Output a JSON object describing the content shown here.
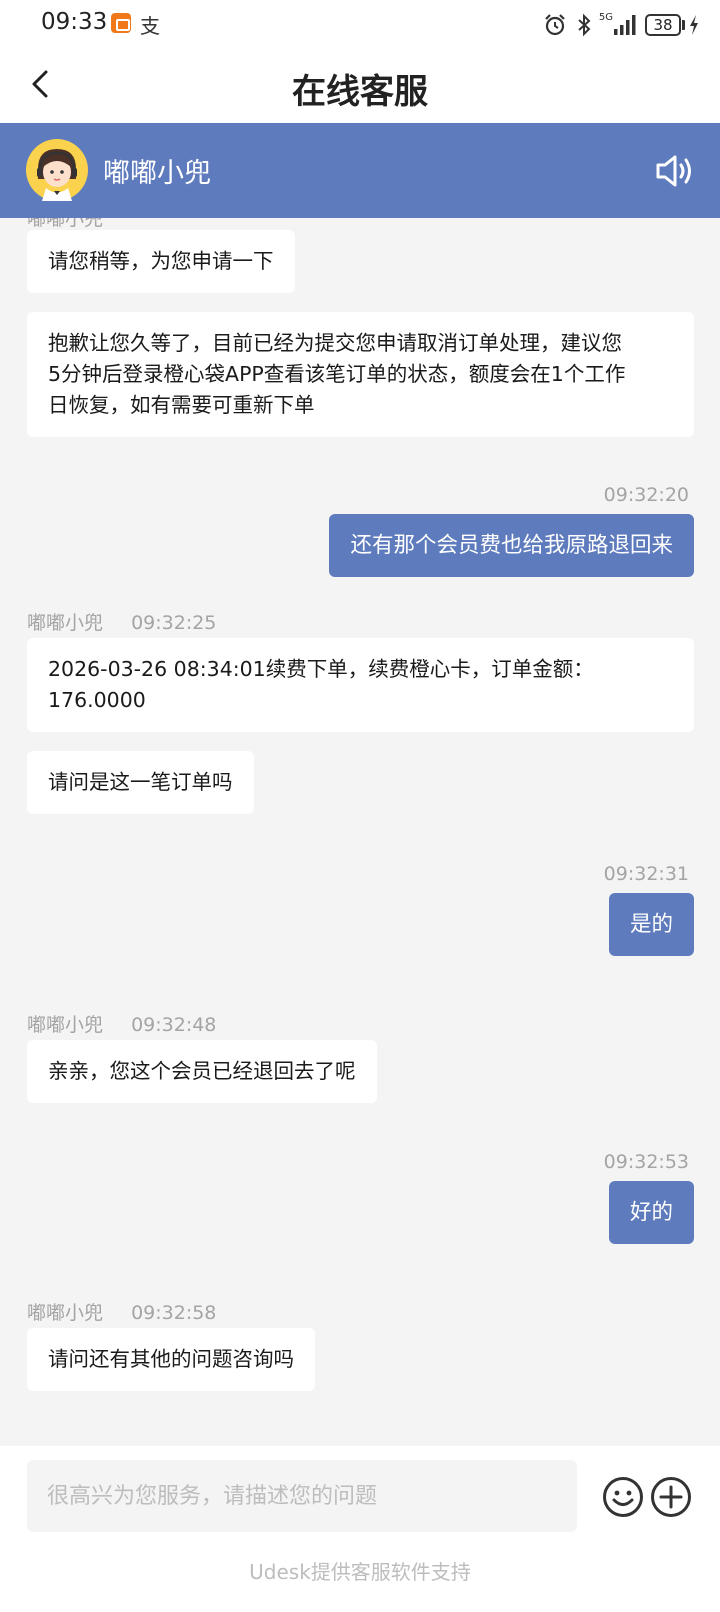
{
  "status_bar": {
    "time": "09:33",
    "pay_glyph": "支",
    "network": "5G",
    "battery": "38",
    "icons": [
      "app-badge-icon",
      "alipay-icon",
      "alarm-icon",
      "bluetooth-icon",
      "signal-icon",
      "battery-icon",
      "charging-icon"
    ]
  },
  "header": {
    "title": "在线客服",
    "back_icon": "chevron-left-icon"
  },
  "agent": {
    "name": "嘟嘟小兜",
    "avatar_icon": "agent-avatar-icon",
    "speaker_icon": "speaker-icon"
  },
  "messages": [
    {
      "side": "in",
      "text": "请您稍等，为您申请一下"
    },
    {
      "side": "in",
      "lines": [
        "抱歉让您久等了，目前已经为提交您申请取消订单处理，建议您",
        "5分钟后登录橙心袋APP查看该笔订单的状态，额度会在1个工作",
        "日恢复，如有需要可重新下单"
      ]
    },
    {
      "side": "out",
      "time": "09:32:20",
      "text": "还有那个会员费也给我原路退回来"
    },
    {
      "side": "in",
      "sender": "嘟嘟小兜",
      "time": "09:32:25",
      "lines": [
        "2026-03-26 08:34:01续费下单，续费橙心卡，订单金额：",
        "176.0000"
      ]
    },
    {
      "side": "in",
      "text": "请问是这一笔订单吗"
    },
    {
      "side": "out",
      "time": "09:32:31",
      "text": "是的"
    },
    {
      "side": "in",
      "sender": "嘟嘟小兜",
      "time": "09:32:48",
      "text": "亲亲，您这个会员已经退回去了呢"
    },
    {
      "side": "out",
      "time": "09:32:53",
      "text": "好的"
    },
    {
      "side": "in",
      "sender": "嘟嘟小兜",
      "time": "09:32:58",
      "text": "请问还有其他的问题咨询吗"
    }
  ],
  "composer": {
    "placeholder": "很高兴为您服务，请描述您的问题",
    "emoji_icon": "emoji-icon",
    "add_icon": "plus-circle-icon",
    "powered_by": "Udesk提供客服软件支持"
  },
  "colors": {
    "accent": "#5e7bbd",
    "background": "#f4f4f4",
    "bubble_in": "#ffffff",
    "meta_text": "#a4a4a4"
  }
}
